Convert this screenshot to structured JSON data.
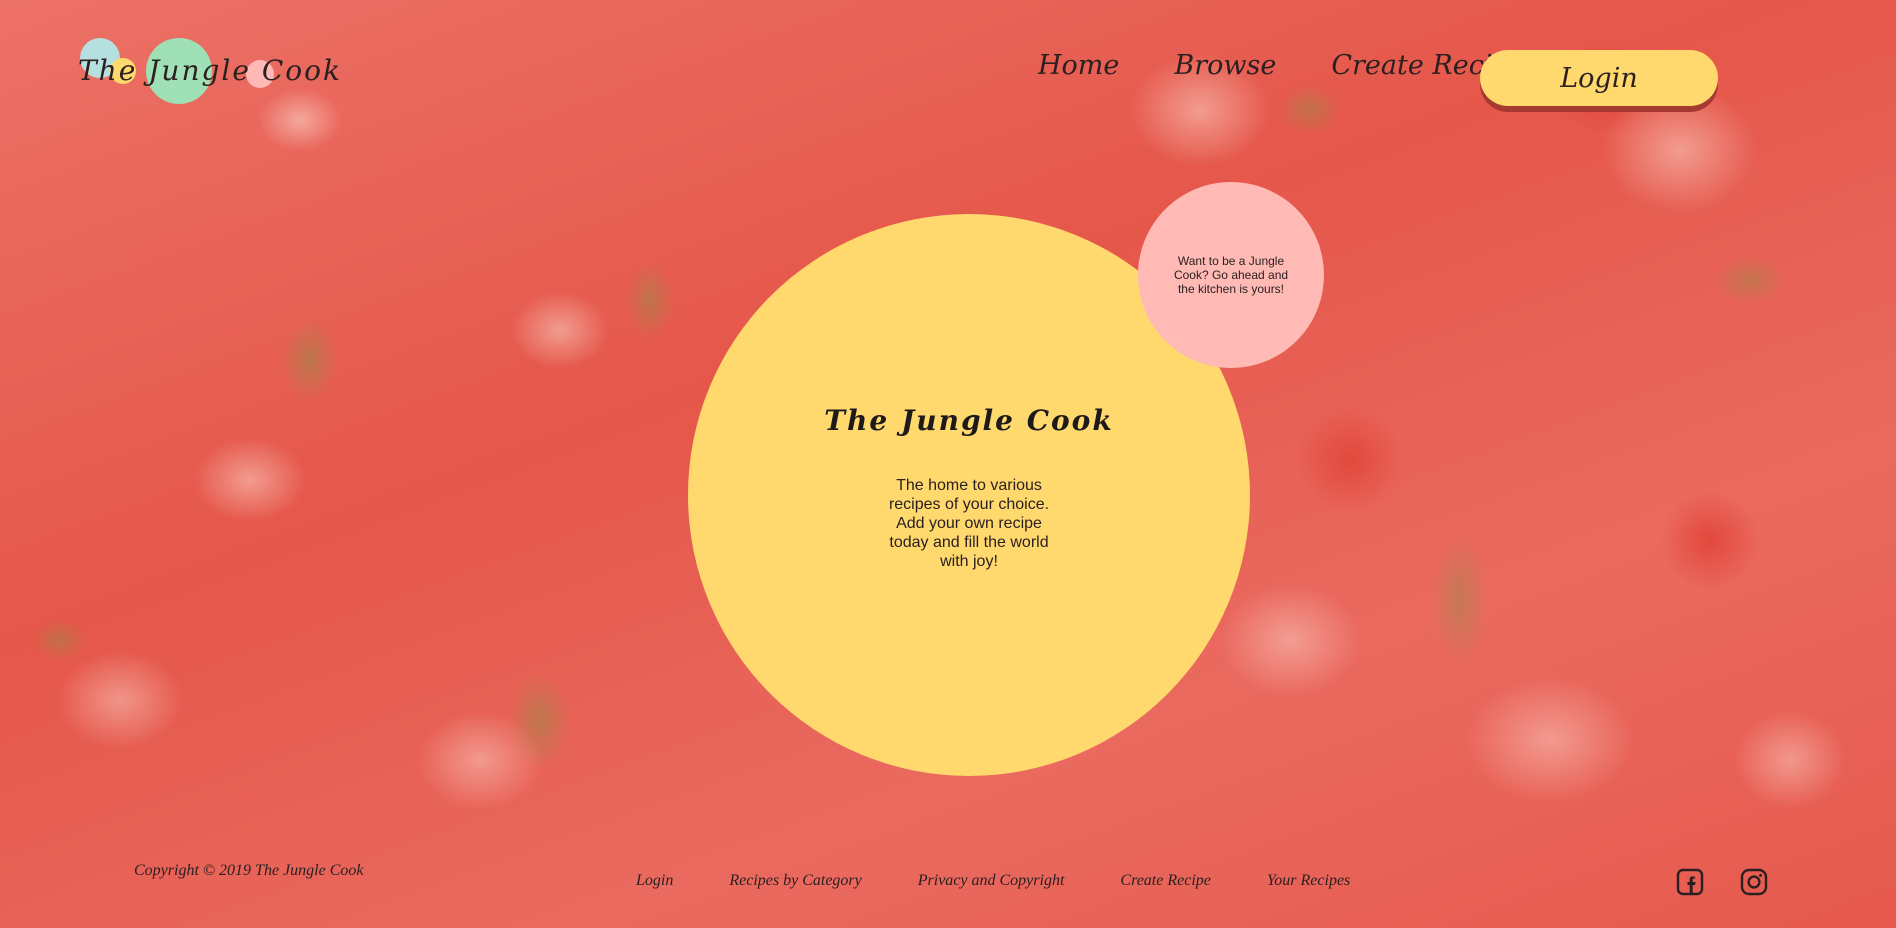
{
  "header": {
    "logo_text": "The Jungle Cook",
    "nav": [
      "Home",
      "Browse",
      "Create Recipe"
    ],
    "login_label": "Login"
  },
  "hero": {
    "title": "The Jungle Cook",
    "text": "The home to various recipes of your choice. Add your own recipe today and fill the world with joy!",
    "bubble_text": "Want to be a Jungle Cook? Go ahead and the kitchen is yours!"
  },
  "footer": {
    "copyright": "Copyright © 2019 The Jungle Cook",
    "links": [
      "Login",
      "Recipes by Category",
      "Privacy and Copyright",
      "Create Recipe",
      "Your Recipes"
    ],
    "social_icons": [
      "facebook-icon",
      "instagram-icon"
    ]
  },
  "colors": {
    "accent_yellow": "#ffd86e",
    "bubble_pink": "#ffbab6",
    "logo_teal": "#b5e0df",
    "logo_green": "#9fe0b6",
    "background_red": "#e86a5e"
  }
}
